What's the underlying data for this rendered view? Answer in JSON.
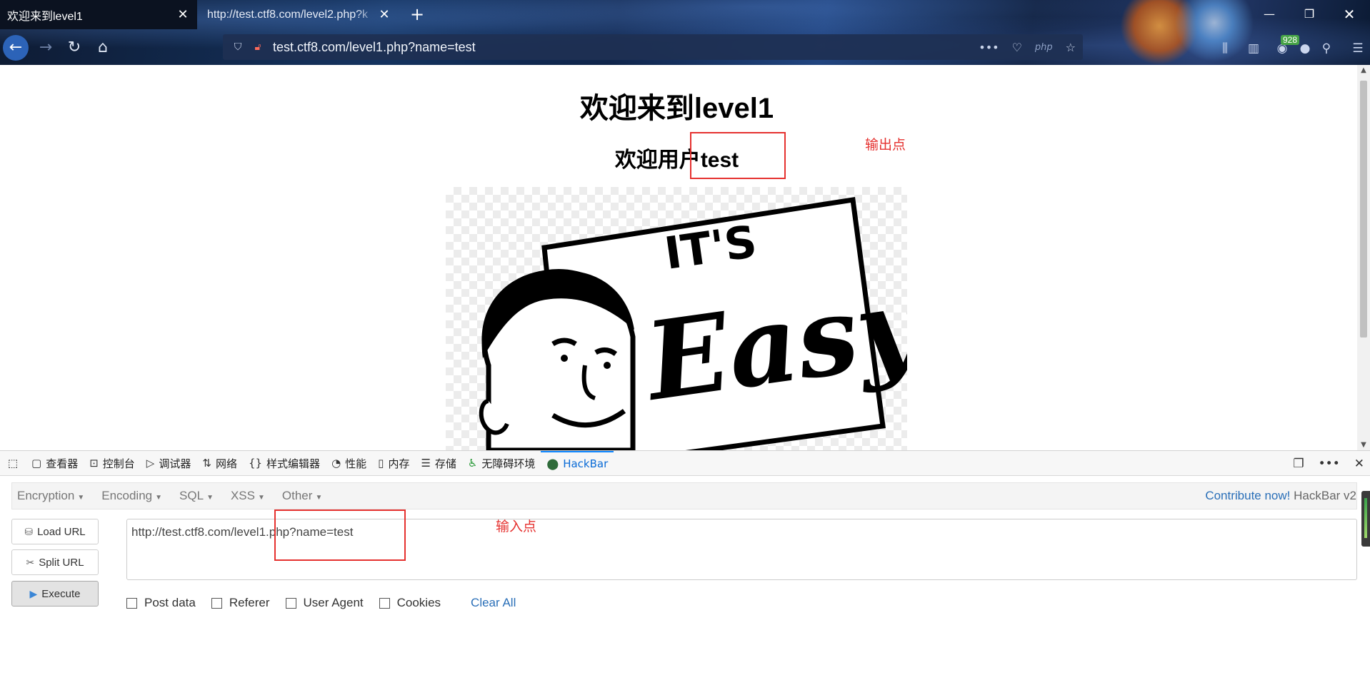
{
  "browser": {
    "tabs": [
      {
        "title": "欢迎来到level1",
        "active": true
      },
      {
        "title": "http://test.ctf8.com/level2.php?k",
        "active": false
      }
    ],
    "url": "test.ctf8.com/level1.php?name=test",
    "url_php_badge": "php",
    "badge_count": "928"
  },
  "page": {
    "heading": "欢迎来到level1",
    "user_line_prefix": "欢迎用户",
    "user_name": "test",
    "image_caption": "IT'S Easy",
    "annotation_output": "输出点"
  },
  "devtools": {
    "tabs": [
      {
        "label": "查看器",
        "icon": "inspector-icon"
      },
      {
        "label": "控制台",
        "icon": "console-icon"
      },
      {
        "label": "调试器",
        "icon": "debugger-icon"
      },
      {
        "label": "网络",
        "icon": "network-icon"
      },
      {
        "label": "样式编辑器",
        "icon": "style-editor-icon"
      },
      {
        "label": "性能",
        "icon": "performance-icon"
      },
      {
        "label": "内存",
        "icon": "memory-icon"
      },
      {
        "label": "存储",
        "icon": "storage-icon"
      },
      {
        "label": "无障碍环境",
        "icon": "accessibility-icon"
      },
      {
        "label": "HackBar",
        "icon": "hackbar-icon",
        "active": true
      }
    ]
  },
  "hackbar": {
    "menu": [
      "Encryption",
      "Encoding",
      "SQL",
      "XSS",
      "Other"
    ],
    "contribute_link": "Contribute now!",
    "version": "HackBar v2",
    "buttons": {
      "load": "Load URL",
      "split": "Split URL",
      "execute": "Execute"
    },
    "url_value": "http://test.ctf8.com/level1.php?name=test",
    "options": [
      "Post data",
      "Referer",
      "User Agent",
      "Cookies"
    ],
    "clear_all": "Clear All",
    "annotation_input": "输入点"
  },
  "colors": {
    "annotation_red": "#e5312f",
    "link_blue": "#2a6fb8",
    "active_tab_blue": "#0a84ff"
  }
}
